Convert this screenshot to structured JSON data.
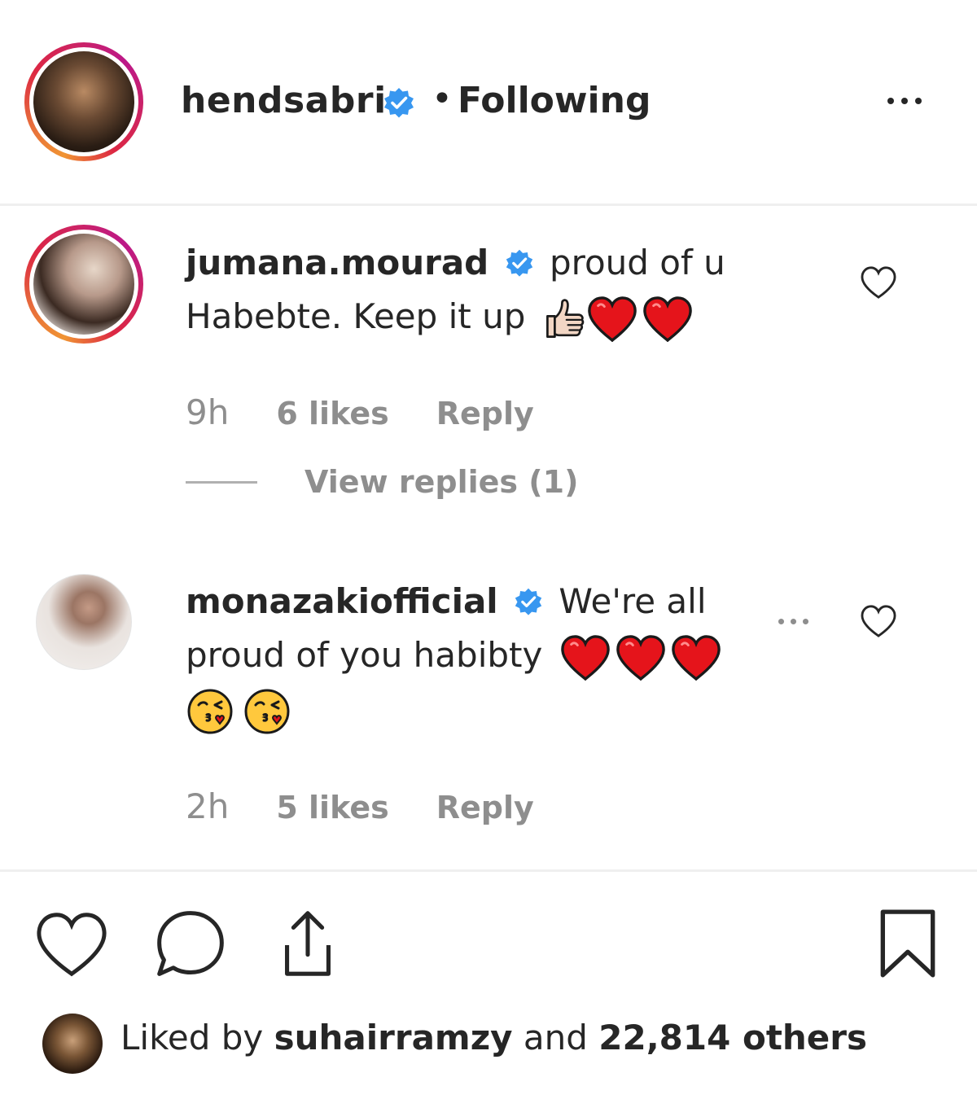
{
  "header": {
    "username": "hendsabri",
    "separator": "•",
    "follow_status": "Following"
  },
  "comments": [
    {
      "username": "jumana.mourad",
      "text": "proud of u Habebte. Keep it up",
      "emojis": [
        "thumbs-up",
        "red-heart",
        "red-heart"
      ],
      "time": "9h",
      "likes": "6 likes",
      "reply": "Reply",
      "view_replies": "View replies (1)"
    },
    {
      "username": "monazakiofficial",
      "text": "We're all proud of you habibty",
      "emojis": [
        "red-heart",
        "red-heart",
        "red-heart",
        "kissing-face",
        "kissing-face"
      ],
      "time": "2h",
      "likes": "5 likes",
      "reply": "Reply"
    }
  ],
  "liked_by": {
    "prefix": "Liked by",
    "user": "suhairramzy",
    "middle": "and",
    "others": "22,814 others"
  },
  "colors": {
    "text": "#262626",
    "muted": "#8e8e8e",
    "verified": "#3897f0",
    "heart": "#ed2024"
  }
}
